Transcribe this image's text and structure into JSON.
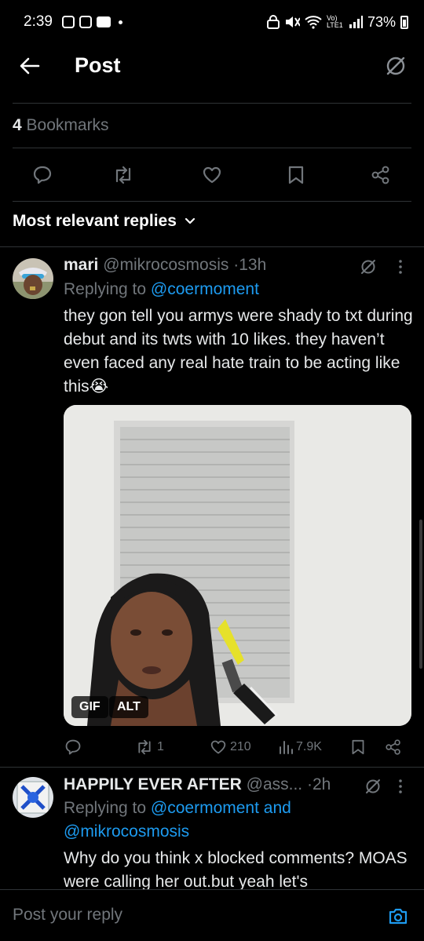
{
  "status_bar": {
    "time": "2:39",
    "signal_text": "Vo) LTE1",
    "battery": "73%"
  },
  "header": {
    "title": "Post"
  },
  "stats": {
    "bookmark_count": "4",
    "bookmark_label": "Bookmarks"
  },
  "sort": {
    "label": "Most relevant replies"
  },
  "replies": [
    {
      "name": "mari",
      "handle": "@mikrocosmosis",
      "time": "13h",
      "replying_prefix": "Replying to",
      "replying_to": "@coermoment",
      "text": "they gon tell you armys were shady to txt during debut and its twts with 10 likes. they haven’t even faced any real hate train to be acting like this😭",
      "media": {
        "badge_gif": "GIF",
        "badge_alt": "ALT"
      },
      "actions": {
        "retweets": "1",
        "likes": "210",
        "views": "7.9K"
      }
    },
    {
      "name": "HAPPILY EVER AFTER",
      "handle": "@ass...",
      "time": "2h",
      "replying_prefix": "Replying to",
      "replying_to": "@coermoment and",
      "replying_to_2": "@mikrocosmosis",
      "text": "Why do you think x blocked comments? MOAS were calling her out.but yeah let's"
    }
  ],
  "composer": {
    "placeholder": "Post your reply"
  },
  "colors": {
    "accent": "#1d9bf0",
    "muted": "#71767b",
    "text": "#e7e9ea",
    "background": "#000000"
  }
}
